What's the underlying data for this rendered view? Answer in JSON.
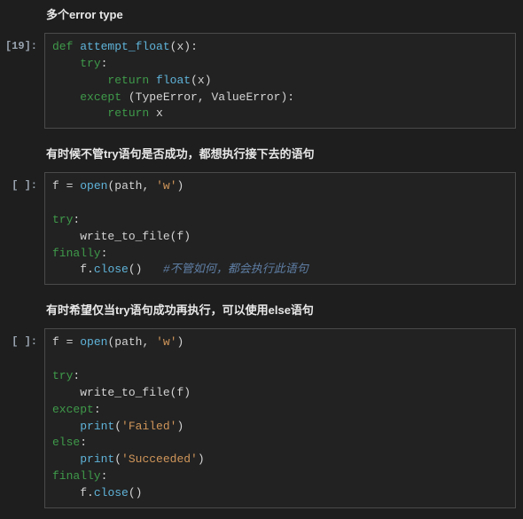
{
  "md": {
    "m0": "多个error type",
    "m1": "有时候不管try语句是否成功，都想执行接下去的语句",
    "m2": "有时希望仅当try语句成功再执行，可以使用else语句"
  },
  "cells": {
    "c0": {
      "prompt": "[19]:",
      "kw_def": "def",
      "fn": "attempt_float",
      "paren_open": "(",
      "px": "x",
      "paren_close_colon": "):",
      "kw_try": "try",
      "colon": ":",
      "kw_return1": "return",
      "bi_float": "float",
      "paren_open2": "(",
      "px2": "x",
      "paren_close2": ")",
      "kw_except": "except",
      "paren_open3": " (",
      "te": "TypeError",
      "comma": ", ",
      "ve": "ValueError",
      "paren_close3": "):",
      "kw_return2": "return",
      "px3": " x"
    },
    "c1": {
      "prompt": "[ ]:",
      "lf": "f ",
      "eq": "=",
      "sp": " ",
      "bi_open": "open",
      "po": "(",
      "path": "path",
      "cm1": ", ",
      "sw": "'w'",
      "pc": ")",
      "blank": "",
      "kw_try": "try",
      "colon": ":",
      "wtf": "write_to_file",
      "po2": "(",
      "lf2": "f",
      "pc2": ")",
      "kw_finally": "finally",
      "colon2": ":",
      "lf3": "f",
      "dot": ".",
      "close_fn": "close",
      "po3": "(",
      "pc3": ")",
      "sp2": "   ",
      "comment": "#不管如何，都会执行此语句"
    },
    "c2": {
      "prompt": "[ ]:",
      "lf": "f ",
      "eq": "=",
      "sp": " ",
      "bi_open": "open",
      "po": "(",
      "path": "path",
      "cm1": ", ",
      "sw": "'w'",
      "pc": ")",
      "blank": "",
      "kw_try": "try",
      "colon": ":",
      "wtf": "write_to_file",
      "po2": "(",
      "lf2": "f",
      "pc2": ")",
      "kw_except": "except",
      "colon2": ":",
      "bi_print1": "print",
      "po3": "(",
      "s_failed": "'Failed'",
      "pc3": ")",
      "kw_else": "else",
      "colon3": ":",
      "bi_print2": "print",
      "po4": "(",
      "s_succ": "'Succeeded'",
      "pc4": ")",
      "kw_finally": "finally",
      "colon4": ":",
      "lf3": "f",
      "dot": ".",
      "close_fn": "close",
      "po5": "(",
      "pc5": ")"
    }
  }
}
